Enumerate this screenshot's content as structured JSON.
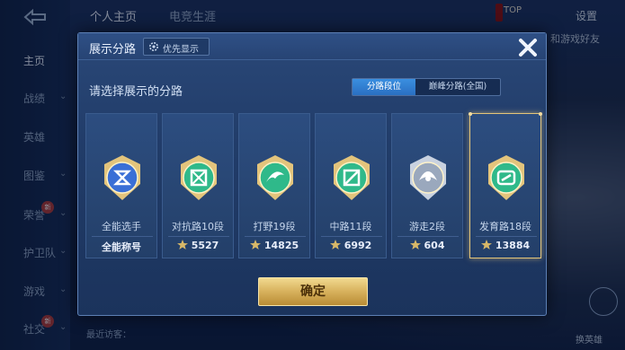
{
  "background": {
    "back_glyph": "⟲",
    "top_tabs": [
      "个人主页",
      "电竞生涯"
    ],
    "settings_label": "设置",
    "top_right_link": "和游戏好友",
    "top_badge": "TOP",
    "sidebar": [
      {
        "label": "主页",
        "chevron": false,
        "active": true
      },
      {
        "label": "战绩",
        "chevron": true
      },
      {
        "label": "英雄",
        "chevron": false
      },
      {
        "label": "图鉴",
        "chevron": true
      },
      {
        "label": "荣誉",
        "chevron": true,
        "badge": "新"
      },
      {
        "label": "护卫队",
        "chevron": true
      },
      {
        "label": "游戏",
        "chevron": true
      },
      {
        "label": "社交",
        "chevron": true,
        "badge": "新"
      }
    ],
    "bottom_text": "最近访客：",
    "right_label": "换英雄"
  },
  "modal": {
    "title": "展示分路",
    "priority_label": "优先显示",
    "prompt": "请选择展示的分路",
    "toggle": [
      {
        "label": "分路段位",
        "active": true
      },
      {
        "label": "巅峰分路(全国)",
        "active": false
      }
    ],
    "cards": [
      {
        "name": "全能选手",
        "score": "全能称号",
        "has_star": false,
        "emblem": "allround",
        "selected": false
      },
      {
        "name": "对抗路10段",
        "score": "5527",
        "has_star": true,
        "emblem": "clash",
        "selected": false
      },
      {
        "name": "打野19段",
        "score": "14825",
        "has_star": true,
        "emblem": "jungle",
        "selected": false
      },
      {
        "name": "中路11段",
        "score": "6992",
        "has_star": true,
        "emblem": "mid",
        "selected": false
      },
      {
        "name": "游走2段",
        "score": "604",
        "has_star": true,
        "emblem": "roam",
        "selected": false
      },
      {
        "name": "发育路18段",
        "score": "13884",
        "has_star": true,
        "emblem": "farm",
        "selected": true
      }
    ],
    "confirm_label": "确定"
  },
  "colors": {
    "accent_gold": "#e4c57a",
    "tab_active_blue": "#3a8fe0",
    "emblem_green": "#2fb98a",
    "emblem_blue": "#3a6fd6"
  }
}
